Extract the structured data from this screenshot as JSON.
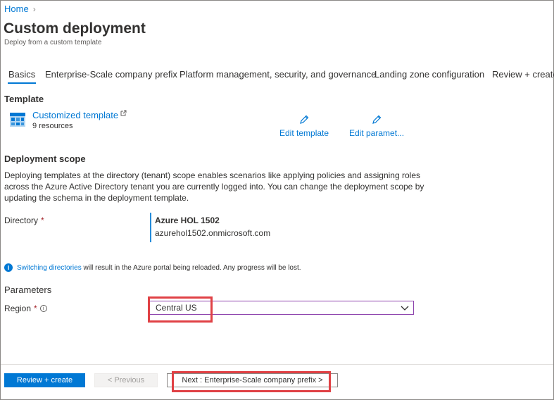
{
  "breadcrumb": {
    "home": "Home"
  },
  "page": {
    "title": "Custom deployment",
    "subtitle": "Deploy from a custom template"
  },
  "tabs": [
    {
      "label": "Basics",
      "active": true
    },
    {
      "label": "Enterprise-Scale company prefix"
    },
    {
      "label": "Platform management, security, and governance"
    },
    {
      "label": "Landing zone configuration"
    },
    {
      "label": "Review + create"
    }
  ],
  "template": {
    "heading": "Template",
    "name": "Customized template",
    "resources": "9 resources",
    "edit_template": "Edit template",
    "edit_parameters": "Edit paramet..."
  },
  "scope": {
    "heading": "Deployment scope",
    "description": "Deploying templates at the directory (tenant) scope enables scenarios like applying policies and assigning roles across the Azure Active Directory tenant you are currently logged into. You can change the deployment scope by updating the schema in the deployment template.",
    "directory_label": "Directory",
    "required_mark": "*",
    "directory_name": "Azure HOL 1502",
    "directory_domain": "azurehol1502.onmicrosoft.com"
  },
  "info": {
    "link": "Switching directories",
    "text": "will result in the Azure portal being reloaded. Any progress will be lost."
  },
  "parameters": {
    "heading": "Parameters",
    "region_label": "Region",
    "required_mark": "*",
    "region_value": "Central US"
  },
  "footer": {
    "review_create": "Review + create",
    "previous": "< Previous",
    "next": "Next : Enterprise-Scale company prefix >"
  },
  "colors": {
    "accent": "#0078d4",
    "highlight": "#e04145",
    "required": "#a4262c"
  }
}
